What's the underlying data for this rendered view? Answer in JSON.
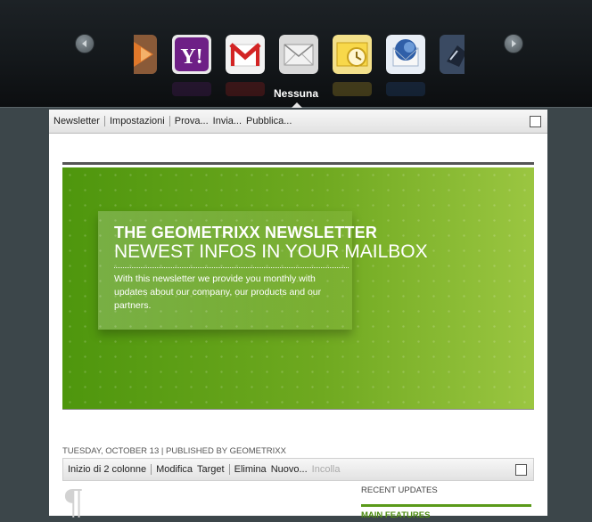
{
  "carousel": {
    "selected_label": "Nessuna",
    "tiles": [
      "firefox-mail-icon",
      "yahoo-mail-icon",
      "gmail-icon",
      "generic-mail-icon",
      "outlook-icon",
      "thunderbird-icon",
      "blackberry-icon"
    ]
  },
  "editbar": {
    "items": [
      "Newsletter",
      "Impostazioni",
      "Prova...",
      "Invia...",
      "Pubblica..."
    ]
  },
  "newsletter": {
    "title": "THE GEOMETRIXX NEWSLETTER",
    "subtitle": "NEWEST INFOS IN YOUR MAILBOX",
    "intro": "With this newsletter we provide you monthly with updates about our company, our products and our partners."
  },
  "meta": "TUESDAY, OCTOBER 13 | PUBLISHED BY GEOMETRIXX",
  "colbar": {
    "items": [
      "Inizio di 2 colonne",
      "Modifica",
      "Target",
      "Elimina",
      "Nuovo...",
      "Incolla"
    ]
  },
  "sidebar": {
    "recent_updates": "RECENT UPDATES",
    "main_features": "MAIN FEATURES"
  },
  "colors": {
    "accent_green": "#5a9a1a",
    "hero_green": "#6fa920"
  }
}
